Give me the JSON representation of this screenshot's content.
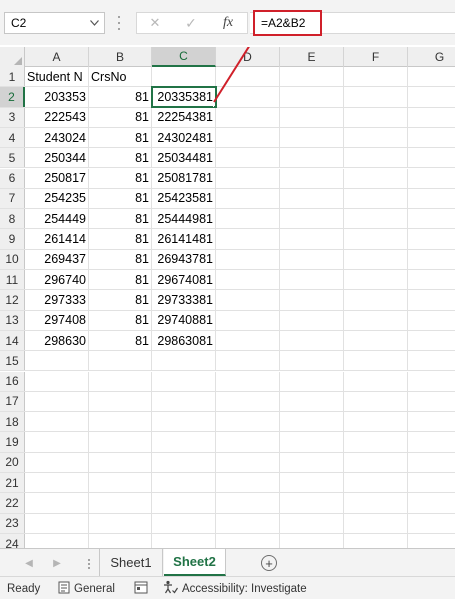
{
  "formula_bar": {
    "name_box": "C2",
    "formula": "=A2&B2",
    "tools": {
      "cancel_glyph": "✕",
      "enter_glyph": "✓",
      "fx_glyph": "fx"
    }
  },
  "columns": [
    "A",
    "B",
    "C",
    "D",
    "E",
    "F",
    "G"
  ],
  "selected_column": "C",
  "rows": [
    {
      "n": "1",
      "a": "Student N",
      "b": "CrsNo",
      "c": ""
    },
    {
      "n": "2",
      "a": "203353",
      "b": "81",
      "c": "20335381"
    },
    {
      "n": "3",
      "a": "222543",
      "b": "81",
      "c": "22254381"
    },
    {
      "n": "4",
      "a": "243024",
      "b": "81",
      "c": "24302481"
    },
    {
      "n": "5",
      "a": "250344",
      "b": "81",
      "c": "25034481"
    },
    {
      "n": "6",
      "a": "250817",
      "b": "81",
      "c": "25081781"
    },
    {
      "n": "7",
      "a": "254235",
      "b": "81",
      "c": "25423581"
    },
    {
      "n": "8",
      "a": "254449",
      "b": "81",
      "c": "25444981"
    },
    {
      "n": "9",
      "a": "261414",
      "b": "81",
      "c": "26141481"
    },
    {
      "n": "10",
      "a": "269437",
      "b": "81",
      "c": "26943781"
    },
    {
      "n": "11",
      "a": "296740",
      "b": "81",
      "c": "29674081"
    },
    {
      "n": "12",
      "a": "297333",
      "b": "81",
      "c": "29733381"
    },
    {
      "n": "13",
      "a": "297408",
      "b": "81",
      "c": "29740881"
    },
    {
      "n": "14",
      "a": "298630",
      "b": "81",
      "c": "29863081"
    },
    {
      "n": "15",
      "a": "",
      "b": "",
      "c": ""
    },
    {
      "n": "16",
      "a": "",
      "b": "",
      "c": ""
    },
    {
      "n": "17",
      "a": "",
      "b": "",
      "c": ""
    },
    {
      "n": "18",
      "a": "",
      "b": "",
      "c": ""
    },
    {
      "n": "19",
      "a": "",
      "b": "",
      "c": ""
    },
    {
      "n": "20",
      "a": "",
      "b": "",
      "c": ""
    },
    {
      "n": "21",
      "a": "",
      "b": "",
      "c": ""
    },
    {
      "n": "22",
      "a": "",
      "b": "",
      "c": ""
    },
    {
      "n": "23",
      "a": "",
      "b": "",
      "c": ""
    },
    {
      "n": "24",
      "a": "",
      "b": "",
      "c": ""
    }
  ],
  "selected_row": "2",
  "sheet_tabs": [
    {
      "label": "Sheet1",
      "active": false
    },
    {
      "label": "Sheet2",
      "active": true
    }
  ],
  "add_sheet_glyph": "+",
  "status_bar": {
    "ready": "Ready",
    "number_format": "General",
    "accessibility": "Accessibility: Investigate"
  },
  "colors": {
    "accent_green": "#217346",
    "callout_red": "#d0202a"
  }
}
